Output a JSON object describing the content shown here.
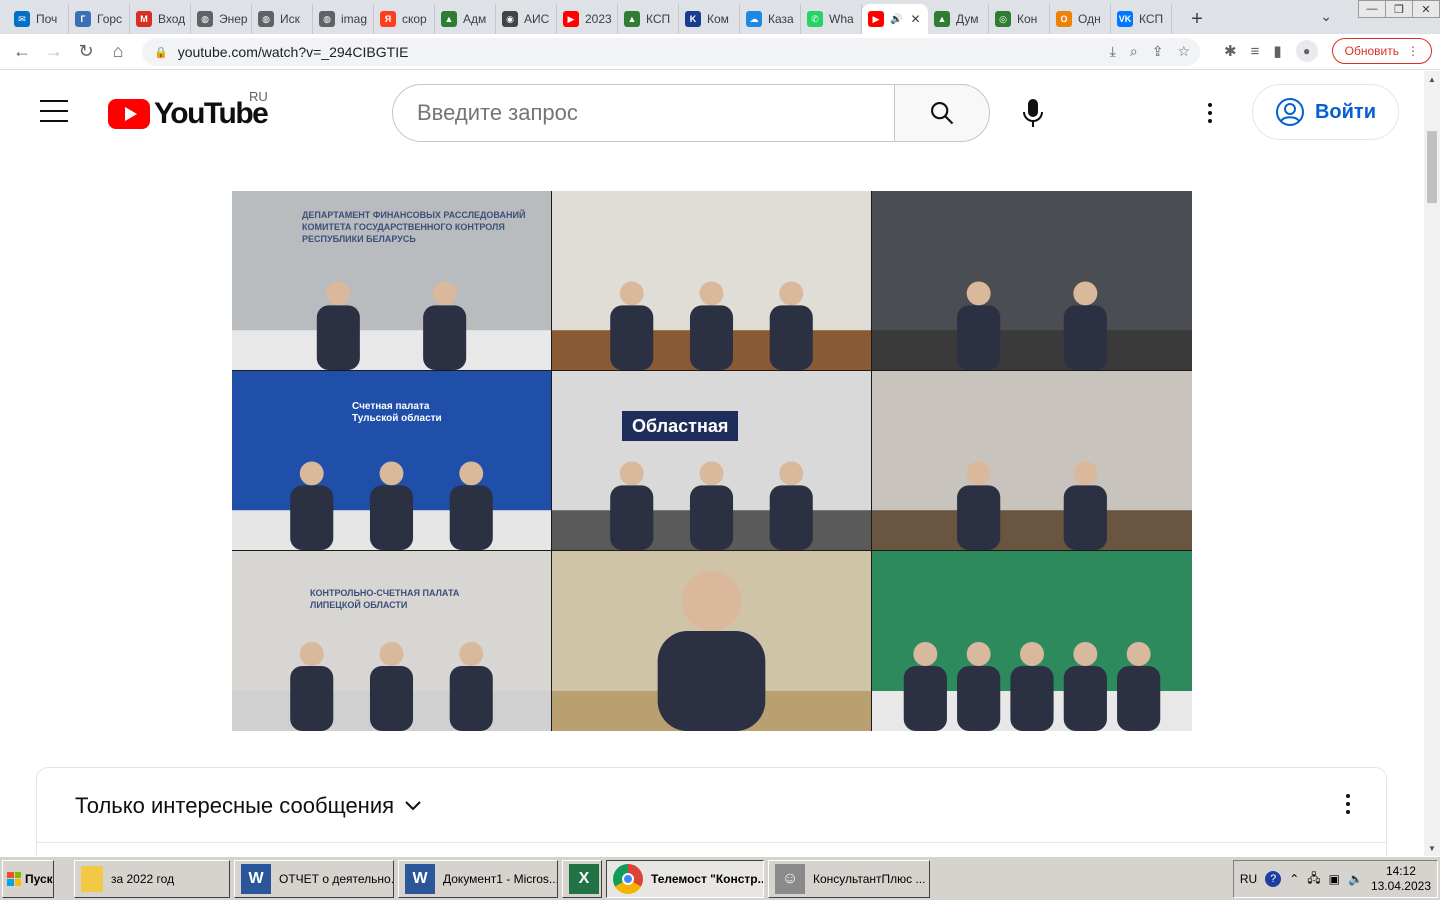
{
  "browser": {
    "tabs": [
      {
        "label": "Поч",
        "color": "#0072c6",
        "glyph": "✉"
      },
      {
        "label": "Горс",
        "color": "#3d6fb5",
        "glyph": "Г"
      },
      {
        "label": "Вход",
        "color": "#d93025",
        "glyph": "M"
      },
      {
        "label": "Энер",
        "color": "#5f6368",
        "glyph": "◍"
      },
      {
        "label": "Иск",
        "color": "#5f6368",
        "glyph": "◍"
      },
      {
        "label": "imag",
        "color": "#5f6368",
        "glyph": "◍"
      },
      {
        "label": "скор",
        "color": "#fc3f1d",
        "glyph": "Я"
      },
      {
        "label": "Адм",
        "color": "#2e7d32",
        "glyph": "▲"
      },
      {
        "label": "АИС",
        "color": "#444444",
        "glyph": "◉"
      },
      {
        "label": "2023",
        "color": "#ff0000",
        "glyph": "▶"
      },
      {
        "label": "КСП",
        "color": "#2e7d32",
        "glyph": "▲"
      },
      {
        "label": "Ком",
        "color": "#1a3c8f",
        "glyph": "K"
      },
      {
        "label": "Каза",
        "color": "#1e88e5",
        "glyph": "☁"
      },
      {
        "label": "Wha",
        "color": "#25d366",
        "glyph": "✆"
      },
      {
        "label": "",
        "color": "#ff0000",
        "glyph": "▶",
        "active": true
      },
      {
        "label": "Дум",
        "color": "#2e7d32",
        "glyph": "▲"
      },
      {
        "label": "Кон",
        "color": "#2e7d32",
        "glyph": "◎"
      },
      {
        "label": "Одн",
        "color": "#ee8208",
        "glyph": "О"
      },
      {
        "label": "КСП",
        "color": "#0077ff",
        "glyph": "VK"
      }
    ],
    "url": "youtube.com/watch?v=_294CIBGTIE",
    "update_label": "Обновить"
  },
  "youtube": {
    "logo_text": "YouTube",
    "region": "RU",
    "search_placeholder": "Введите запрос",
    "signin_label": "Войти"
  },
  "video": {
    "cells": [
      {
        "caption": "ДЕПАРТАМЕНТ ФИНАНСОВЫХ РАССЛЕДОВАНИЙ КОМИТЕТА ГОСУДАРСТВЕННОГО КОНТРОЛЯ РЕСПУБЛИКИ БЕЛАРУСЬ",
        "bg": "#b9bcbf"
      },
      {
        "caption": "",
        "bg": "#e0dcd6"
      },
      {
        "caption": "",
        "bg": "#4a4d52"
      },
      {
        "caption": "Счетная палата Тульской области",
        "bg": "#1f4fa8"
      },
      {
        "caption": "Областная",
        "bg": "#d9d9d9"
      },
      {
        "caption": "",
        "bg": "#c8c4bd"
      },
      {
        "caption": "КОНТРОЛЬНО-СЧЕТНАЯ ПАЛАТА ЛИПЕЦКОЙ ОБЛАСТИ",
        "bg": "#d8d6d3"
      },
      {
        "caption": "",
        "bg": "#cfc4a8"
      },
      {
        "caption": "",
        "bg": "#2c8a5c"
      }
    ]
  },
  "chat": {
    "title": "Только интересные сообщения"
  },
  "taskbar": {
    "start_label": "Пуск",
    "items": [
      {
        "label": "за 2022 год",
        "icon": "folder"
      },
      {
        "label": "ОТЧЕТ о деятельно...",
        "icon": "word"
      },
      {
        "label": "Документ1 - Micros...",
        "icon": "word"
      },
      {
        "label": "",
        "icon": "excel"
      },
      {
        "label": "Телемост \"Констр...",
        "icon": "chrome",
        "active": true
      },
      {
        "label": "КонсультантПлюс ...",
        "icon": "consultant"
      }
    ],
    "lang": "RU",
    "time": "14:12",
    "date": "13.04.2023"
  }
}
